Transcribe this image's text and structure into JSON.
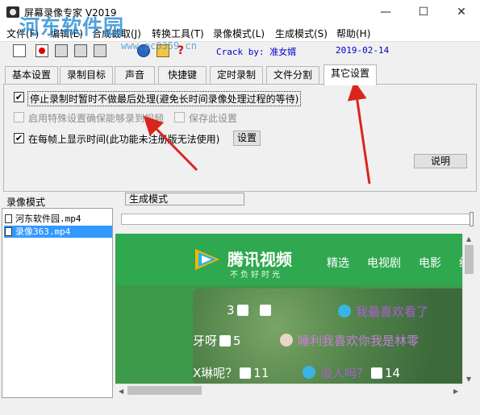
{
  "window": {
    "title": "屏幕录像专家 V2019",
    "watermark": "河东软件园",
    "watermark_url": "www.pc0359.cn",
    "minimize": "—",
    "maximize": "☐",
    "close": "✕"
  },
  "menu": [
    "文件(F)",
    "编辑(E)",
    "合成截取(J)",
    "转换工具(T)",
    "录像模式(L)",
    "生成模式(S)",
    "帮助(H)"
  ],
  "toolbar": {
    "crack_text": "Crack by: 准女婿",
    "date_text": "2019-02-14"
  },
  "tabs": [
    "基本设置",
    "录制目标",
    "声音",
    "快捷键",
    "定时录制",
    "文件分割",
    "其它设置"
  ],
  "options": {
    "stop_processing": {
      "label": "停止录制时暂时不做最后处理(避免长时间录像处理过程的等待)",
      "checked": "✔"
    },
    "special_settings": {
      "label": "启用特殊设置确保能够录到视频"
    },
    "save_settings": {
      "label": "保存此设置"
    },
    "show_time": {
      "label": "在每帧上显示时间(此功能未注册版无法使用)",
      "checked": "✔"
    },
    "settings_button": "设置",
    "help_button": "说明"
  },
  "lower": {
    "list_header": "录像模式",
    "mode_label": "生成模式",
    "files": [
      "河东软件园.mp4",
      "录像363.mp4"
    ]
  },
  "preview": {
    "brand": "腾讯视频",
    "slogan": "不负好时光",
    "nav": [
      "精选",
      "电视剧",
      "电影",
      "综"
    ],
    "danmaku": {
      "d1_count": "3",
      "d1_text": "我最喜欢看了",
      "d2_prefix": "牙呀",
      "d2_count": "5",
      "d2_text": "睡利我喜欢你我是林零",
      "d3_prefix": "X琳呢？",
      "d3_count": "11",
      "d3_text": "没人吗？",
      "d3_count2": "14"
    }
  },
  "colors": {
    "annotation_red": "#d9261c",
    "selection": "#3399ff",
    "tencent_green": "#2fa84f",
    "crack_blue": "#0000cc"
  }
}
